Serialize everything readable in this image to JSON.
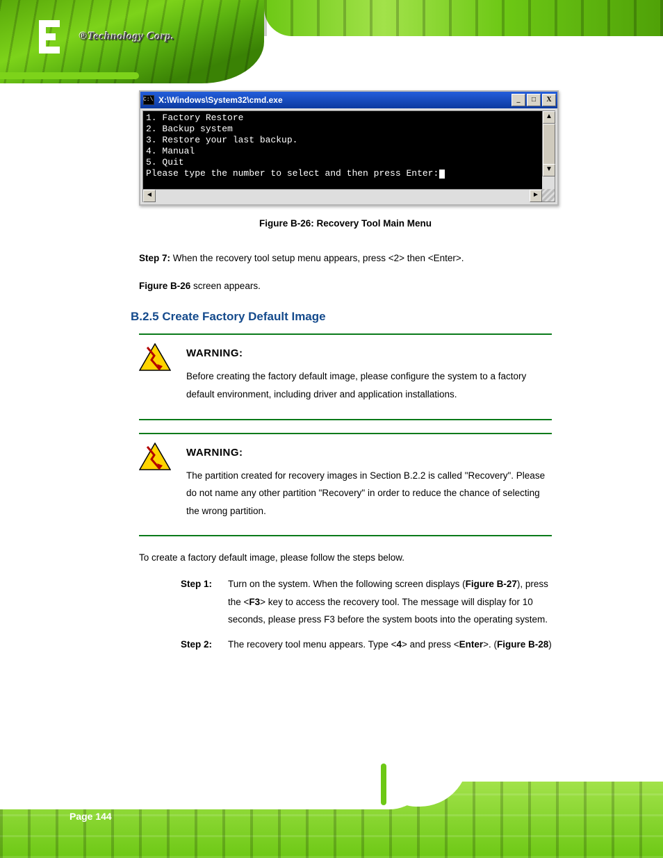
{
  "brand": {
    "company_text": "®Technology Corp.",
    "logo_letters": "iEi"
  },
  "cmd": {
    "title": "X:\\Windows\\System32\\cmd.exe",
    "lines": "1. Factory Restore\n2. Backup system\n3. Restore your last backup.\n4. Manual\n5. Quit\nPlease type the number to select and then press Enter:",
    "btn_min": "_",
    "btn_max": "□",
    "btn_close": "X",
    "arrow_up": "▲",
    "arrow_down": "▼",
    "arrow_left": "◄",
    "arrow_right": "►"
  },
  "figure_caption": "Figure B-26: Recovery Tool Main Menu",
  "lead_step_before": "Step 7:",
  "lead_step_after": " screen appears.",
  "lead_step_body": " When the recovery tool setup menu appears, press <",
  "lead_step_key": "2",
  "lead_step_tail": "> then <Enter>.",
  "section_title": "B.2.5  Create Factory Default Image",
  "warn1": {
    "head": "WARNING:",
    "text": "Before creating the factory default image, please configure the system to a factory default environment, including driver and application installations."
  },
  "warn2": {
    "head": "WARNING:",
    "text": "The partition created for recovery images in Section B.2.2 is called \"Recovery\". Please do not name any other partition \"Recovery\" in order to reduce the chance of selecting the wrong partition."
  },
  "body_text": "To create a factory default image, please follow the steps below.",
  "step1_num": "Step 1:",
  "step1_a": " Turn on the system. When the following screen displays (",
  "step1_fig": "Figure B-27",
  "step1_b": "), press the <",
  "step1_key": "F3",
  "step1_c": "> key to access the recovery tool. The message will display for 10 seconds, please press F3 before the system boots into the operating system.",
  "step2_num": "Step 2:",
  "step2_a": " The recovery tool menu appears. Type <",
  "step2_key": "4",
  "step2_b": "> and press <",
  "step2_enter": "Enter",
  "step2_c": ">. (",
  "step2_fig": "Figure B-28",
  "step2_d": ")",
  "page_number": "Page 144",
  "figure_ref": "Figure B-26"
}
